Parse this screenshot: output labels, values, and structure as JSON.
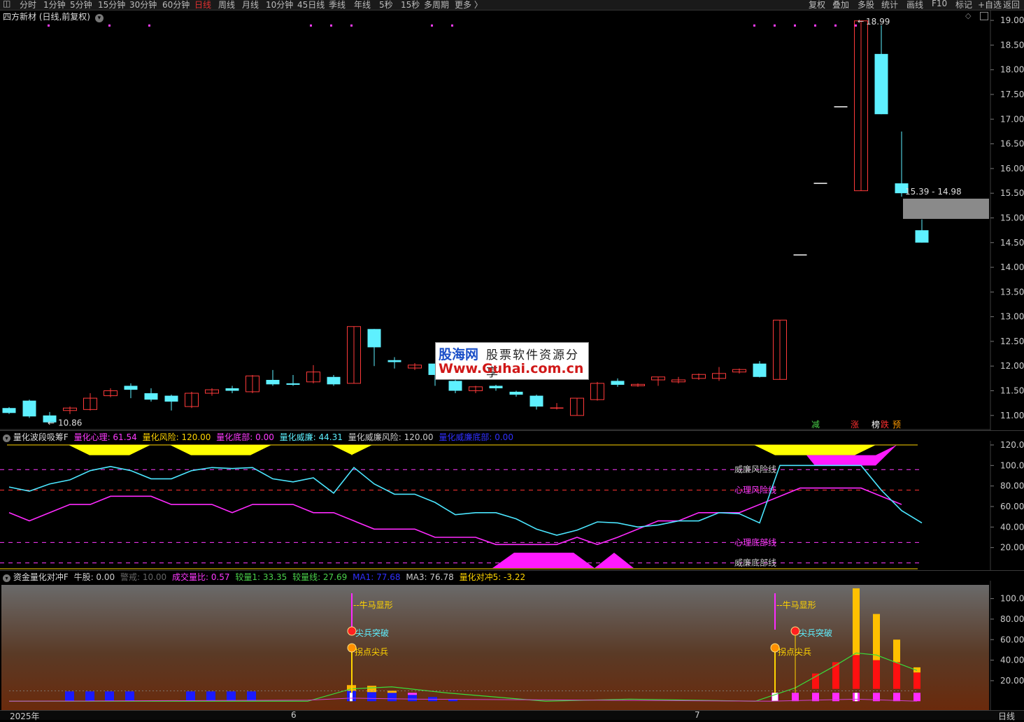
{
  "toolbar": {
    "tabs": [
      "分时",
      "1分钟",
      "5分钟",
      "15分钟",
      "30分钟",
      "60分钟",
      "日线",
      "周线",
      "月线",
      "10分钟",
      "45日线",
      "季线",
      "年线",
      "5秒",
      "15秒",
      "多周期",
      "更多 〉"
    ],
    "active_tab": "日线",
    "right_buttons": [
      "复权",
      "叠加",
      "多股",
      "统计",
      "画线",
      "标记",
      "+自选",
      "返回"
    ],
    "f10": "F10"
  },
  "main_panel": {
    "title": "四方新材 (日线,前复权)",
    "y_ticks": [
      "19.00",
      "18.50",
      "18.00",
      "17.50",
      "17.00",
      "16.50",
      "16.00",
      "15.50",
      "15.00",
      "14.50",
      "14.00",
      "13.50",
      "13.00",
      "12.50",
      "12.00",
      "11.50",
      "11.00"
    ],
    "high_label": "18.99",
    "low_label": "10.86",
    "gap_label": "15.39 - 14.98",
    "markers": [
      {
        "text": "减",
        "color": "#4ad04a"
      },
      {
        "text": "涨",
        "color": "#ff3030"
      },
      {
        "text": "榜",
        "color": "#ffffff"
      },
      {
        "text": "跌",
        "color": "#ff3030"
      },
      {
        "text": "预",
        "color": "#ff9a00"
      }
    ]
  },
  "indicator1": {
    "name": "量化波段吸筹F",
    "values": [
      {
        "label": "量化心理: 61.54",
        "color": "#ff3aff"
      },
      {
        "label": "量化风险: 120.00",
        "color": "#ffd400"
      },
      {
        "label": "量化底部: 0.00",
        "color": "#ff3aff"
      },
      {
        "label": "量化威廉: 44.31",
        "color": "#5ef0ff"
      },
      {
        "label": "量化威廉风险: 120.00",
        "color": "#cccccc"
      },
      {
        "label": "量化威廉底部: 0.00",
        "color": "#3030ff"
      }
    ],
    "y_ticks": [
      "120.0",
      "100.0",
      "80.00",
      "60.00",
      "40.00",
      "20.00"
    ],
    "line_labels": [
      {
        "text": "威廉风险线",
        "color": "#cccccc"
      },
      {
        "text": "心理风险线",
        "color": "#ff3aff"
      },
      {
        "text": "心理底部线",
        "color": "#ff3aff"
      },
      {
        "text": "威廉底部线",
        "color": "#cccccc"
      }
    ]
  },
  "indicator2": {
    "name": "资金量化对冲F",
    "values": [
      {
        "label": "牛股: 0.00",
        "color": "#cccccc"
      },
      {
        "label": "警戒: 10.00",
        "color": "#666666"
      },
      {
        "label": "成交量比: 0.57",
        "color": "#ff3aff"
      },
      {
        "label": "较量1: 33.35",
        "color": "#4ad04a"
      },
      {
        "label": "较量线: 27.69",
        "color": "#4ad04a"
      },
      {
        "label": "MA1: 77.68",
        "color": "#3030ff"
      },
      {
        "label": "MA3: 76.78",
        "color": "#cccccc"
      },
      {
        "label": "量化对冲5: -3.22",
        "color": "#ffd400"
      }
    ],
    "y_ticks": [
      "100.0",
      "80.00",
      "60.00",
      "40.00",
      "20.00"
    ],
    "signals": [
      "--牛马显形",
      "尖兵突破",
      "拐点尖兵",
      "--牛马显形",
      "尖兵突破",
      "拐点尖兵"
    ]
  },
  "x_axis": {
    "labels": [
      "2025年",
      "6",
      "7"
    ],
    "period": "日线"
  },
  "watermark": {
    "brand": "股海网",
    "slogan": "股票软件资源分享",
    "url": "Www.Guhai.com.cn"
  },
  "chart_data": {
    "type": "candlestick",
    "y_range": [
      10.7,
      19.2
    ],
    "candles": [
      [
        11.15,
        11.05,
        11.17,
        11.03
      ],
      [
        11.3,
        10.98,
        11.32,
        10.95
      ],
      [
        11.0,
        10.86,
        11.07,
        10.86
      ],
      [
        11.1,
        11.15,
        11.18,
        11.03
      ],
      [
        11.12,
        11.35,
        11.45,
        11.1
      ],
      [
        11.4,
        11.5,
        11.55,
        11.37
      ],
      [
        11.6,
        11.52,
        11.65,
        11.35
      ],
      [
        11.45,
        11.32,
        11.55,
        11.28
      ],
      [
        11.4,
        11.28,
        11.42,
        11.1
      ],
      [
        11.18,
        11.45,
        11.48,
        11.15
      ],
      [
        11.45,
        11.52,
        11.55,
        11.4
      ],
      [
        11.55,
        11.5,
        11.6,
        11.45
      ],
      [
        11.48,
        11.8,
        11.82,
        11.45
      ],
      [
        11.72,
        11.63,
        11.92,
        11.6
      ],
      [
        11.65,
        11.62,
        11.82,
        11.6
      ],
      [
        11.68,
        11.88,
        12.02,
        11.65
      ],
      [
        11.78,
        11.63,
        11.82,
        11.6
      ],
      [
        11.65,
        12.8,
        12.8,
        11.65
      ],
      [
        12.75,
        12.38,
        12.75,
        12.0
      ],
      [
        12.12,
        12.08,
        12.18,
        11.95
      ],
      [
        11.96,
        12.02,
        12.06,
        11.92
      ],
      [
        12.05,
        11.82,
        12.05,
        11.6
      ],
      [
        11.7,
        11.5,
        11.72,
        11.45
      ],
      [
        11.5,
        11.58,
        11.6,
        11.45
      ],
      [
        11.6,
        11.55,
        11.62,
        11.5
      ],
      [
        11.48,
        11.42,
        11.5,
        11.38
      ],
      [
        11.4,
        11.18,
        11.42,
        11.12
      ],
      [
        11.15,
        11.15,
        11.25,
        11.12
      ],
      [
        11.0,
        11.35,
        11.35,
        11.0
      ],
      [
        11.32,
        11.65,
        11.68,
        11.3
      ],
      [
        11.7,
        11.62,
        11.75,
        11.58
      ],
      [
        11.6,
        11.63,
        11.65,
        11.58
      ],
      [
        11.72,
        11.78,
        11.78,
        11.6
      ],
      [
        11.68,
        11.72,
        11.78,
        11.65
      ],
      [
        11.75,
        11.83,
        11.85,
        11.72
      ],
      [
        11.75,
        11.85,
        11.98,
        11.7
      ],
      [
        11.88,
        11.93,
        11.95,
        11.85
      ],
      [
        12.05,
        11.78,
        12.1,
        11.77
      ],
      [
        11.73,
        12.93,
        12.93,
        11.73
      ],
      [
        14.25,
        14.25,
        14.25,
        14.25
      ],
      [
        15.7,
        15.7,
        15.7,
        15.7
      ],
      [
        17.25,
        17.25,
        17.25,
        17.25
      ],
      [
        15.55,
        18.99,
        18.99,
        15.55
      ],
      [
        18.32,
        17.1,
        18.9,
        17.1
      ],
      [
        15.7,
        15.5,
        16.75,
        15.43
      ],
      [
        14.75,
        14.5,
        14.97,
        14.5
      ]
    ],
    "indicator1_series": [
      {
        "name": "量化心理",
        "values": [
          54,
          46,
          54,
          62,
          62,
          70,
          70,
          70,
          62,
          62,
          62,
          54,
          62,
          62,
          62,
          54,
          54,
          46,
          38,
          38,
          38,
          30,
          30,
          30,
          23,
          23,
          23,
          23,
          30,
          23,
          30,
          38,
          46,
          46,
          54,
          54,
          54,
          62,
          70,
          78,
          78,
          78,
          78,
          70,
          62
        ]
      },
      {
        "name": "量化威廉",
        "values": [
          79,
          75,
          82,
          86,
          95,
          99,
          95,
          87,
          87,
          95,
          98,
          97,
          98,
          87,
          84,
          88,
          73,
          98,
          82,
          72,
          72,
          64,
          52,
          54,
          54,
          48,
          38,
          32,
          37,
          45,
          44,
          40,
          42,
          46,
          46,
          54,
          53,
          44,
          100,
          100,
          100,
          100,
          100,
          76,
          56,
          44
        ]
      }
    ]
  }
}
